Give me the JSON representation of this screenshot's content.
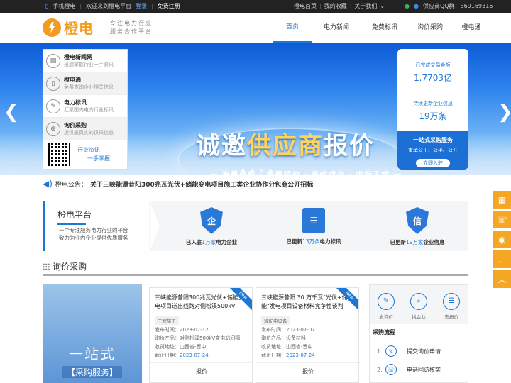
{
  "topbar": {
    "mobile": "手机橙电",
    "welcome": "欢迎来到橙电平台",
    "login": "登录",
    "register": "免费注册",
    "home": "橙电首页",
    "favorites": "我的收藏",
    "about": "关于我们",
    "qq": "供应商QQ群：369169316"
  },
  "header": {
    "logo_text": "橙电",
    "slogan_line1": "专注电力行业",
    "slogan_line2": "服务合作平台",
    "nav": [
      "首页",
      "电力新闻",
      "免费标讯",
      "询价采购",
      "橙电通"
    ]
  },
  "banner": {
    "title_a": "诚邀",
    "title_b": "供应商",
    "title_c": "报价",
    "subtitle": "— 海量商机 · 免费报价 · 高效成交 · 中标无忧 —"
  },
  "side_panel": {
    "items": [
      {
        "title": "橙电新闻网",
        "desc": "迅速掌握行业一手资讯",
        "icon": "news-icon"
      },
      {
        "title": "橙电通",
        "desc": "免费查询企业相关信息",
        "icon": "phone-icon"
      },
      {
        "title": "电力标讯",
        "desc": "汇聚国内电力行业标讯",
        "icon": "bid-icon"
      },
      {
        "title": "询价采购",
        "desc": "提供最真实的供采信息",
        "icon": "cart-icon"
      }
    ],
    "bottom_line1": "行业资讯",
    "bottom_line2": "一手掌握"
  },
  "stats": {
    "label1": "已完成交易金额",
    "value1": "1.7703亿",
    "label2": "持续更新企业信息",
    "value2": "19万条",
    "foot_title": "一站式采购服务",
    "foot_desc": "秉承公正、公平、公开",
    "foot_btn": "立即入驻"
  },
  "notice": {
    "label": "橙电公告：",
    "text": "关于三峡能源昔阳300兆瓦光伏+储能变电项目施工类企业协作分包商公开招标"
  },
  "platform": {
    "title": "橙电平台",
    "desc_line1": "一个专注服务电力行业的平台",
    "desc_line2": "致力为业内企业提供优质服务",
    "features": [
      {
        "pre": "已入驻",
        "num": "1万家",
        "post": "电力企业",
        "icon": "enterprise-icon"
      },
      {
        "pre": "已更新",
        "num": "13万条",
        "post": "电力标讯",
        "icon": "bid-doc-icon"
      },
      {
        "pre": "已更新",
        "num": "19万家",
        "post": "企业信息",
        "icon": "credit-icon"
      }
    ]
  },
  "section": {
    "title": "询价采购"
  },
  "promo": {
    "line1": "一站式",
    "line2": "【采购服务】"
  },
  "cards": [
    {
      "title": "三峡能源昔阳300兆瓦光伏+储能变电项目送出线路对侧松溪500kV",
      "tag": "工程施工",
      "time_label": "发布时间：",
      "time": "2023-07-12",
      "product_label": "询价产品：",
      "product": "对侧松溪500kV变电站间隔",
      "addr_label": "收货地址：",
      "addr": "山西省-晋中",
      "deadline_label": "截止日期：",
      "deadline": "2023-07-24",
      "action": "报价",
      "badge": "New"
    },
    {
      "title": "三峡能源昔阳 30 万千瓦\"光伏+储能\"发电项目设备材料竞争性谈判",
      "tag": "输配电设备",
      "time_label": "发布时间：",
      "time": "2023-07-07",
      "product_label": "询价产品：",
      "product": "设备材料",
      "addr_label": "收货地址：",
      "addr": "山西省-晋中",
      "deadline_label": "截止日期：",
      "deadline": "2023-07-24",
      "action": "报价",
      "badge": "New"
    }
  ],
  "process": {
    "icons": [
      {
        "label": "发询价",
        "icon": "inquiry-icon"
      },
      {
        "label": "找企业",
        "icon": "find-company-icon"
      },
      {
        "label": "去报价",
        "icon": "quote-icon"
      }
    ],
    "title": "采购流程",
    "steps": [
      {
        "n": "1.",
        "text": "提交询价申请"
      },
      {
        "n": "2.",
        "text": "电话回访核实"
      }
    ]
  },
  "colors": {
    "brand_orange": "#f29c1f",
    "brand_blue": "#1c78d4"
  }
}
